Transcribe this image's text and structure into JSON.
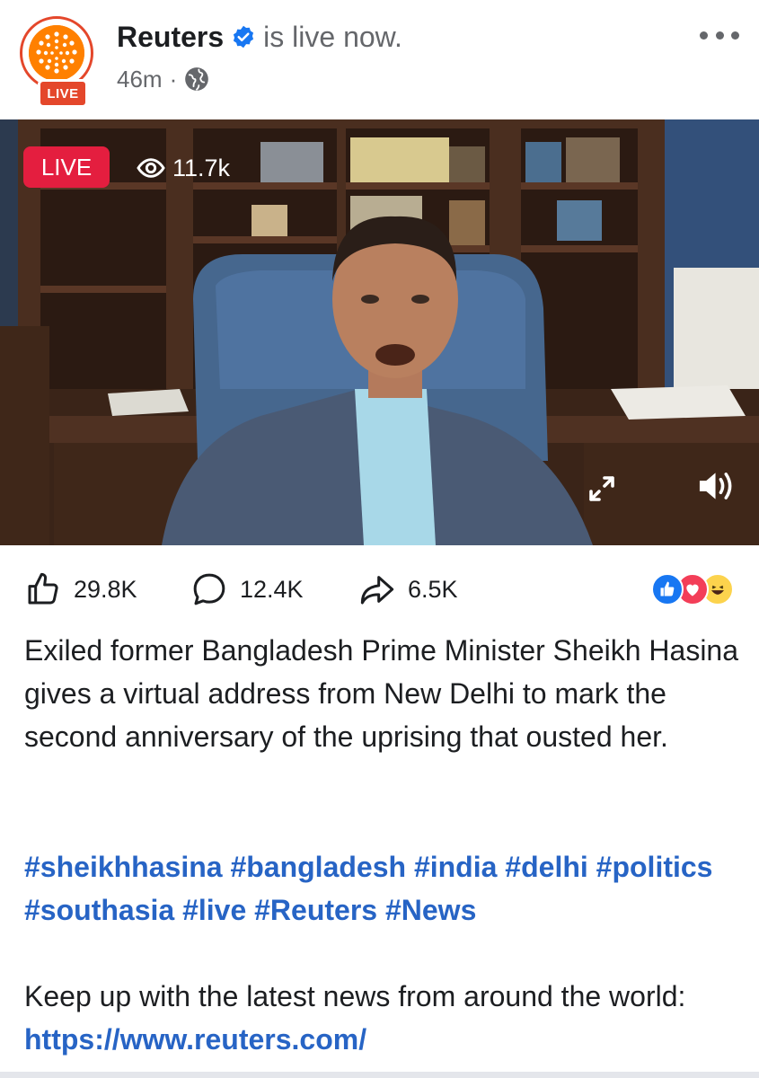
{
  "post": {
    "page_name": "Reuters",
    "status": "is live now.",
    "time": "46m",
    "separator": "·",
    "avatar_badge": "LIVE"
  },
  "video": {
    "live_label": "LIVE",
    "viewer_count": "11.7k"
  },
  "engagement": {
    "likes": "29.8K",
    "comments": "12.4K",
    "shares": "6.5K"
  },
  "caption": "Exiled former Bangladesh Prime Minister Sheikh Hasina gives a virtual address from New Delhi to mark the second anniversary of the uprising that ousted her.",
  "hashtags": [
    "#sheikhhasina",
    "#bangladesh",
    "#india",
    "#delhi",
    "#politics",
    "#southasia",
    "#live",
    "#Reuters",
    "#News"
  ],
  "footer": {
    "text": "Keep up with the latest news from around the world: ",
    "link": "https://www.reuters.com/"
  },
  "colors": {
    "live_red": "#e41e3f",
    "reuters_orange": "#ff8000",
    "link_blue": "#2764c5",
    "verified_blue": "#1877f2"
  },
  "icons": {
    "more": "more-options-icon",
    "globe": "globe-icon",
    "verified": "verified-badge-icon",
    "eye": "eye-icon",
    "expand": "expand-icon",
    "sound": "speaker-icon",
    "like": "thumbs-up-icon",
    "comment": "comment-icon",
    "share": "share-icon"
  }
}
